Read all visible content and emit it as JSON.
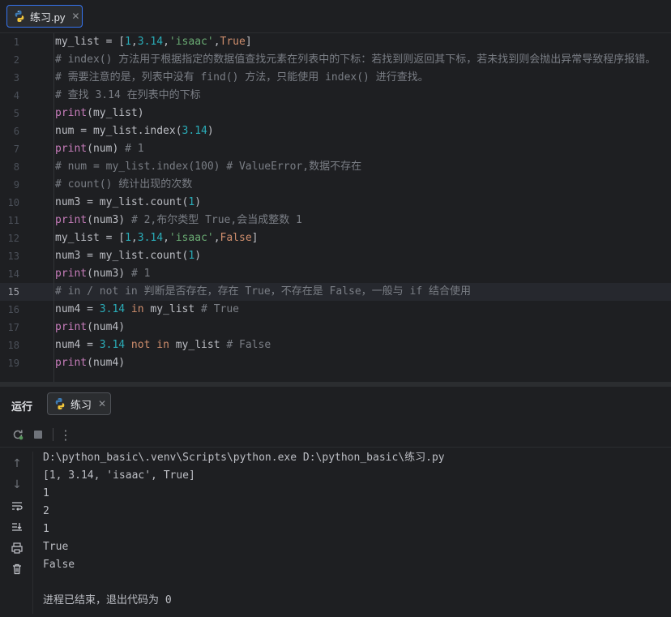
{
  "editor": {
    "tab_label": "练习.py",
    "current_line": 15,
    "lines": [
      [
        {
          "t": "my_list = [",
          "c": "id"
        },
        {
          "t": "1",
          "c": "num"
        },
        {
          "t": ",",
          "c": "id"
        },
        {
          "t": "3.14",
          "c": "num"
        },
        {
          "t": ",",
          "c": "id"
        },
        {
          "t": "'isaac'",
          "c": "str"
        },
        {
          "t": ",",
          "c": "id"
        },
        {
          "t": "True",
          "c": "kw"
        },
        {
          "t": "]",
          "c": "id"
        }
      ],
      [
        {
          "t": "# index() 方法用于根据指定的数据值查找元素在列表中的下标：若找到则返回其下标，若未找到则会抛出异常导致程序报错。",
          "c": "cm"
        }
      ],
      [
        {
          "t": "# 需要注意的是，列表中没有 find() 方法，只能使用 index() 进行查找。",
          "c": "cm"
        }
      ],
      [
        {
          "t": "# 查找 3.14 在列表中的下标",
          "c": "cm"
        }
      ],
      [
        {
          "t": "print",
          "c": "fn"
        },
        {
          "t": "(my_list)",
          "c": "id"
        }
      ],
      [
        {
          "t": "num = my_list.index(",
          "c": "id"
        },
        {
          "t": "3.14",
          "c": "num"
        },
        {
          "t": ")",
          "c": "id"
        }
      ],
      [
        {
          "t": "print",
          "c": "fn"
        },
        {
          "t": "(num) ",
          "c": "id"
        },
        {
          "t": "# 1",
          "c": "cm"
        }
      ],
      [
        {
          "t": "# num = my_list.index(100) # ValueError,数据不存在",
          "c": "cm"
        }
      ],
      [
        {
          "t": "# count() 统计出现的次数",
          "c": "cm"
        }
      ],
      [
        {
          "t": "num3 = my_list.count(",
          "c": "id"
        },
        {
          "t": "1",
          "c": "num"
        },
        {
          "t": ")",
          "c": "id"
        }
      ],
      [
        {
          "t": "print",
          "c": "fn"
        },
        {
          "t": "(num3) ",
          "c": "id"
        },
        {
          "t": "# 2,布尔类型 True,会当成整数 1",
          "c": "cm"
        }
      ],
      [
        {
          "t": "my_list = [",
          "c": "id"
        },
        {
          "t": "1",
          "c": "num"
        },
        {
          "t": ",",
          "c": "id"
        },
        {
          "t": "3.14",
          "c": "num"
        },
        {
          "t": ",",
          "c": "id"
        },
        {
          "t": "'isaac'",
          "c": "str"
        },
        {
          "t": ",",
          "c": "id"
        },
        {
          "t": "False",
          "c": "kw"
        },
        {
          "t": "]",
          "c": "id"
        }
      ],
      [
        {
          "t": "num3 = my_list.count(",
          "c": "id"
        },
        {
          "t": "1",
          "c": "num"
        },
        {
          "t": ")",
          "c": "id"
        }
      ],
      [
        {
          "t": "print",
          "c": "fn"
        },
        {
          "t": "(num3) ",
          "c": "id"
        },
        {
          "t": "# 1",
          "c": "cm"
        }
      ],
      [
        {
          "t": "# in / not in 判断是否存在，存在 True，不存在是 False，一般与 if 结合使用",
          "c": "cm"
        }
      ],
      [
        {
          "t": "num4 = ",
          "c": "id"
        },
        {
          "t": "3.14",
          "c": "num"
        },
        {
          "t": " in ",
          "c": "kw"
        },
        {
          "t": "my_list ",
          "c": "id"
        },
        {
          "t": "# True",
          "c": "cm"
        }
      ],
      [
        {
          "t": "print",
          "c": "fn"
        },
        {
          "t": "(num4)",
          "c": "id"
        }
      ],
      [
        {
          "t": "num4 = ",
          "c": "id"
        },
        {
          "t": "3.14",
          "c": "num"
        },
        {
          "t": " not in ",
          "c": "kw"
        },
        {
          "t": "my_list ",
          "c": "id"
        },
        {
          "t": "# False",
          "c": "cm"
        }
      ],
      [
        {
          "t": "print",
          "c": "fn"
        },
        {
          "t": "(num4)",
          "c": "id"
        }
      ]
    ]
  },
  "run_panel": {
    "title": "运行",
    "tab_label": "练习",
    "output": [
      "D:\\python_basic\\.venv\\Scripts\\python.exe D:\\python_basic\\练习.py",
      "[1, 3.14, 'isaac', True]",
      "1",
      "2",
      "1",
      "True",
      "False",
      "",
      "进程已结束，退出代码为 0"
    ]
  },
  "icons": {
    "file": "python-icon",
    "rerun": "rerun-icon",
    "stop": "stop-icon",
    "more": "more-options-icon",
    "up": "arrow-up-icon",
    "down": "arrow-down-icon",
    "wrap": "soft-wrap-icon",
    "scroll_end": "scroll-to-end-icon",
    "print": "print-icon",
    "clear": "trash-icon"
  },
  "colors": {
    "background": "#1e1f22",
    "keyword": "#cf8e6d",
    "number": "#2aacb8",
    "string": "#6aab73",
    "builtin": "#c77dbb",
    "comment": "#7a7e85",
    "accent": "#3574f0"
  }
}
